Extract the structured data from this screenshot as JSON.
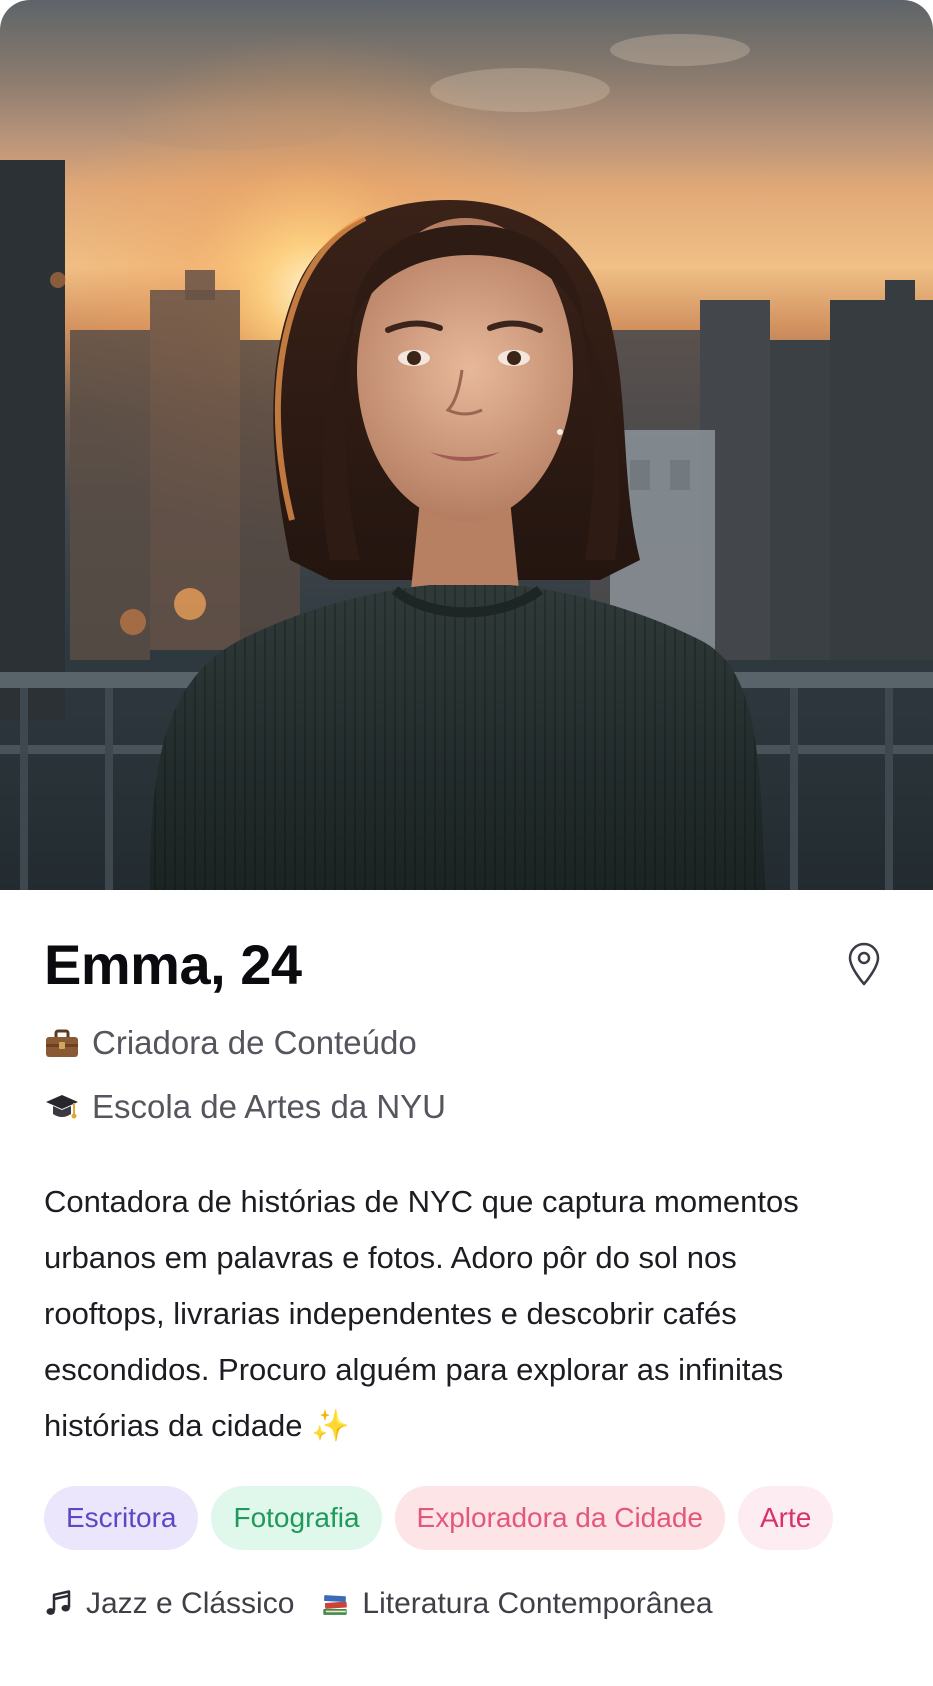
{
  "profile": {
    "name_age": "Emma, 24",
    "job": "Criadora de Conteúdo",
    "school": "Escola de Artes da NYU",
    "bio": "Contadora de histórias de NYC que captura momentos urbanos em palavras e fotos. Adoro pôr do sol nos rooftops, livrarias independentes e descobrir cafés escondidos. Procuro alguém para explorar as infinitas histórias da cidade ✨"
  },
  "icons": {
    "job": "briefcase-icon",
    "school": "graduation-cap-icon",
    "location": "location-pin-icon",
    "music": "music-note-icon",
    "books": "books-icon"
  },
  "tags": [
    {
      "label": "Escritora",
      "bg": "#ebe6fb",
      "color": "#5b48c4"
    },
    {
      "label": "Fotografia",
      "bg": "#e0f7ec",
      "color": "#1f9a5b"
    },
    {
      "label": "Exploradora da Cidade",
      "bg": "#fde4e7",
      "color": "#e2577a"
    },
    {
      "label": "Arte",
      "bg": "#fdecf1",
      "color": "#d9326a"
    }
  ],
  "interests": {
    "music": "Jazz e Clássico",
    "books": "Literatura Contemporânea"
  }
}
